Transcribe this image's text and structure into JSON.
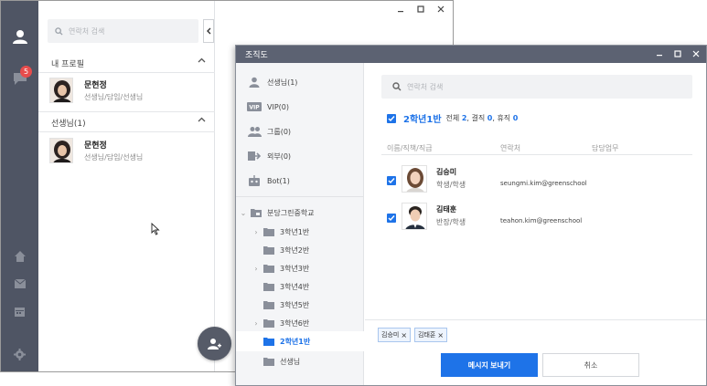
{
  "messenger": {
    "search_placeholder": "연락처 검색",
    "badge_count": "5",
    "my_profile_label": "내 프로필",
    "teacher_section_label": "선생님(1)",
    "profile": {
      "name": "문현정",
      "desc": "선생님/담임/선생님"
    },
    "teacher": {
      "name": "문현정",
      "desc": "선생님/담임/선생님"
    },
    "sidebar_icons": [
      "user-icon",
      "chat-icon",
      "home-icon",
      "mail-icon",
      "calendar-icon",
      "settings-icon"
    ],
    "fab_icon": "add-user-icon"
  },
  "org": {
    "title": "조직도",
    "categories": [
      {
        "label": "선생님(1)",
        "icon": "person-icon"
      },
      {
        "label": "VIP(0)",
        "icon": "vip-icon"
      },
      {
        "label": "그룹(0)",
        "icon": "group-icon"
      },
      {
        "label": "외부(0)",
        "icon": "external-icon"
      },
      {
        "label": "Bot(1)",
        "icon": "bot-icon"
      }
    ],
    "school": "분당그린중학교",
    "classes": [
      "3학년1반",
      "3학년2반",
      "3학년3반",
      "3학년4반",
      "3학년5반",
      "3학년6반",
      "2학년1반",
      "선생님"
    ],
    "selected_class": "2학년1반",
    "search_placeholder": "연락처 검색",
    "group": {
      "name": "2학년1반",
      "total_label": "전체",
      "total": "2",
      "absent_label": "결직",
      "absent": "0",
      "leave_label": "휴직",
      "leave": "0"
    },
    "columns": [
      "이름/직책/직급",
      "연락처",
      "담당업무"
    ],
    "members": [
      {
        "name": "김승미",
        "role": "학생/학생",
        "email": "seungmi.kim@greenschool"
      },
      {
        "name": "김태훈",
        "role": "반장/학생",
        "email": "teahon.kim@greenschool"
      }
    ],
    "chips": [
      "김승미",
      "김태훈"
    ],
    "send_label": "메시지 보내기",
    "cancel_label": "취소"
  },
  "colors": {
    "accent": "#1e73e8",
    "sidebar": "#4f5564",
    "title_bar": "#5c6272",
    "badge": "#e74c4c"
  }
}
